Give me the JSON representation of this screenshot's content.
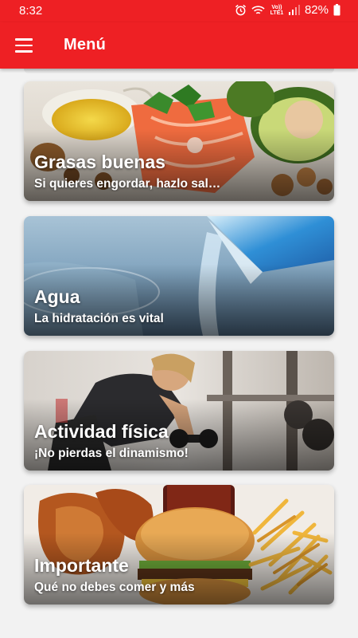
{
  "status_bar": {
    "time": "8:32",
    "alarm_icon": "alarm-icon",
    "wifi_icon": "wifi-icon",
    "network_label": "Vo)) LTE1",
    "signal_icon": "signal-icon",
    "battery_percent": "82%",
    "battery_icon": "battery-icon"
  },
  "app_bar": {
    "menu_icon": "hamburger-menu-icon",
    "title": "Menú",
    "background_color": "#ee2024"
  },
  "cards": [
    {
      "title": "Grasas buenas",
      "subtitle": "Si quieres engordar, hazlo sal…",
      "image": "healthy-fats-photo"
    },
    {
      "title": "Agua",
      "subtitle": "La hidratación es vital",
      "image": "water-pouring-photo"
    },
    {
      "title": "Actividad física",
      "subtitle": "¡No pierdas el dinamismo!",
      "image": "gym-workout-photo"
    },
    {
      "title": "Importante",
      "subtitle": "Qué no debes comer y más",
      "image": "fast-food-photo"
    }
  ]
}
